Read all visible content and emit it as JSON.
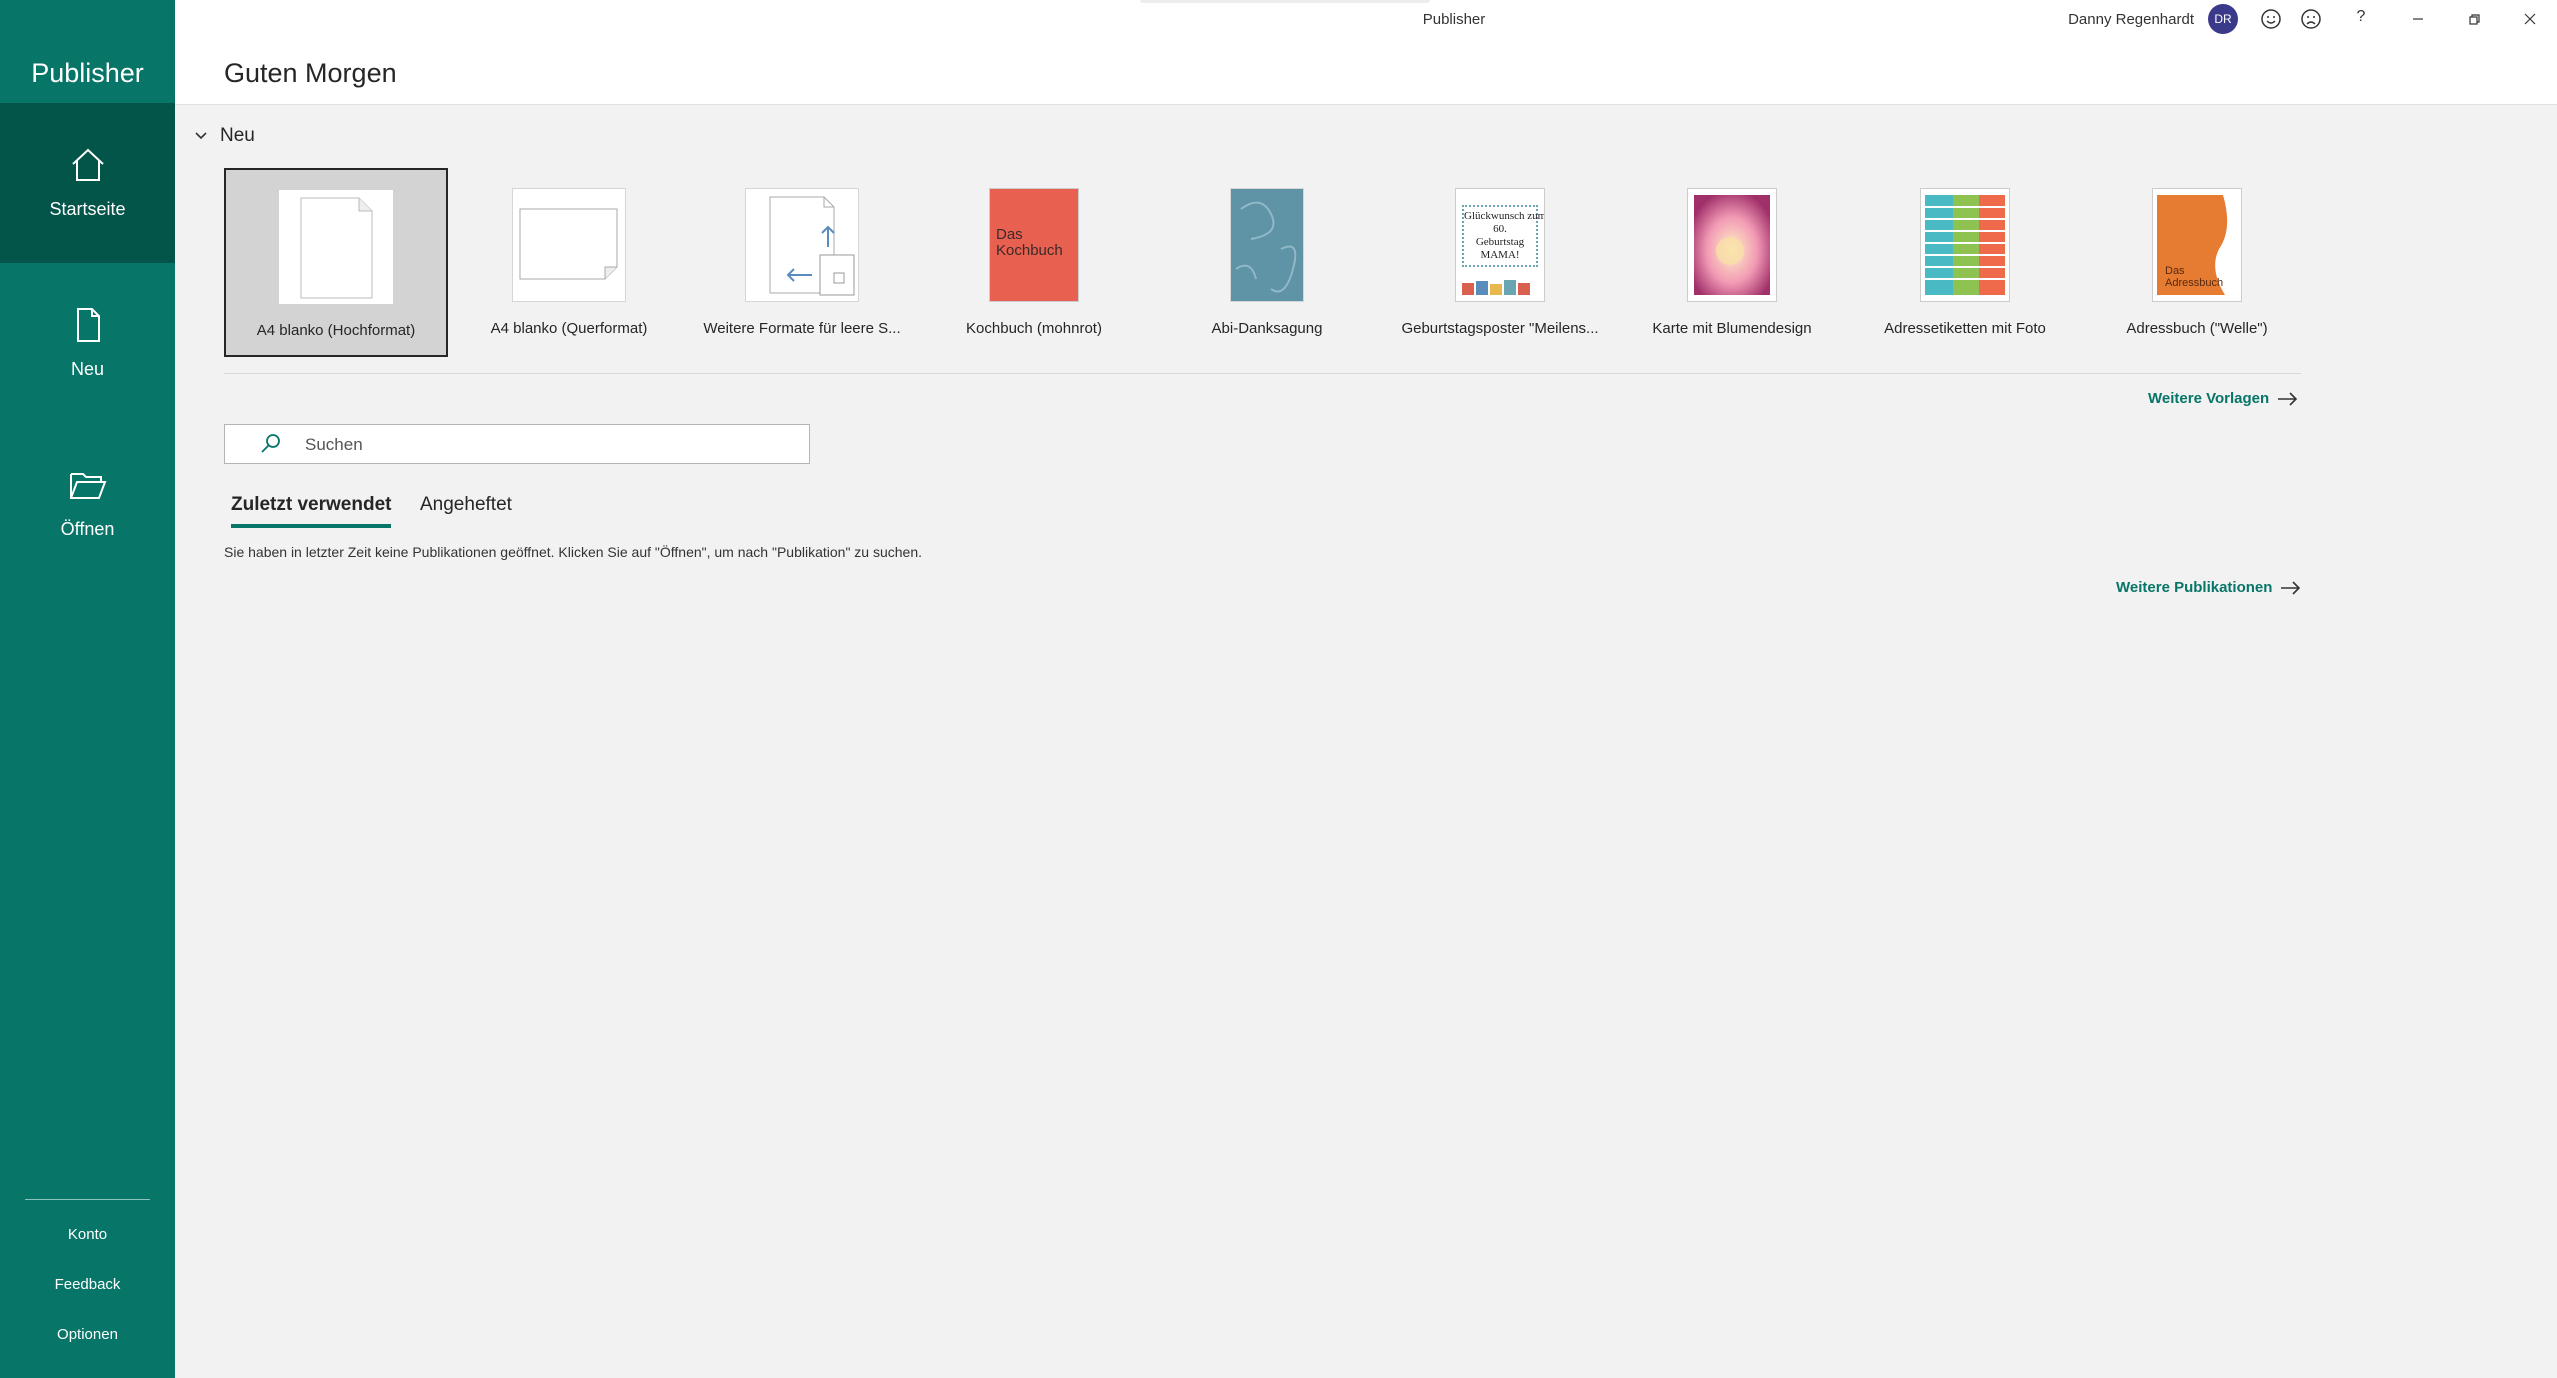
{
  "app": {
    "name": "Publisher",
    "window_title": "Publisher",
    "accent_color": "#077568"
  },
  "sidebar": {
    "items": [
      {
        "label": "Startseite",
        "icon": "home-icon",
        "active": true
      },
      {
        "label": "Neu",
        "icon": "new-document-icon",
        "active": false
      },
      {
        "label": "Öffnen",
        "icon": "folder-open-icon",
        "active": false
      }
    ],
    "bottom_links": [
      "Konto",
      "Feedback",
      "Optionen"
    ]
  },
  "titlebar": {
    "user_name": "Danny Regenhardt",
    "user_initials": "DR",
    "icons": [
      "smile-icon",
      "frown-icon",
      "help-icon",
      "minimize-icon",
      "restore-icon",
      "close-icon"
    ],
    "help_glyph": "?"
  },
  "greeting": "Guten Morgen",
  "new_section": {
    "label": "Neu",
    "templates": [
      {
        "label": "A4 blanko (Hochformat)"
      },
      {
        "label": "A4 blanko (Querformat)"
      },
      {
        "label": "Weitere Formate für leere S..."
      },
      {
        "label": "Kochbuch (mohnrot)",
        "thumb_text": "Das\nKochbuch"
      },
      {
        "label": "Abi-Danksagung"
      },
      {
        "label": "Geburtstagsposter \"Meilens...",
        "thumb_text": "Glückwunsch zum\n60.\nGeburtstag\nMAMA!"
      },
      {
        "label": "Karte mit Blumendesign"
      },
      {
        "label": "Adressetiketten mit Foto"
      },
      {
        "label": "Adressbuch (\"Welle\")",
        "thumb_text": "Das\nAdressbuch"
      }
    ],
    "more_templates": "Weitere Vorlagen"
  },
  "search": {
    "placeholder": "Suchen",
    "value": ""
  },
  "tabs": [
    {
      "label": "Zuletzt verwendet",
      "active": true
    },
    {
      "label": "Angeheftet",
      "active": false
    }
  ],
  "recent": {
    "empty_message": "Sie haben in letzter Zeit keine Publikationen geöffnet. Klicken Sie auf \"Öffnen\", um nach \"Publikation\" zu suchen.",
    "more_publications": "Weitere Publikationen"
  }
}
